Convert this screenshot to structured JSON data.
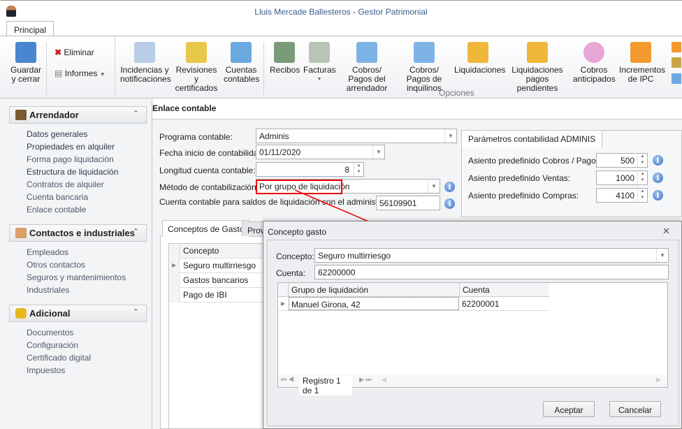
{
  "window": {
    "title": "Lluis Mercade Ballesteros - Gestor Patrimonial"
  },
  "ribbon": {
    "tab": "Principal",
    "group_label": "Opciones",
    "save": "Guardar y cerrar",
    "delete": "Eliminar",
    "reports": "Informes",
    "buttons": [
      "Incidencias y notificaciones",
      "Revisiones y certificados",
      "Cuentas contables",
      "Recibos",
      "Facturas",
      "Cobros/ Pagos del arrendador",
      "Cobros/ Pagos de inquilinos",
      "Liquidaciones",
      "Liquidaciones pagos pendientes",
      "Cobros anticipados",
      "Incrementos de IPC"
    ]
  },
  "sidebar": {
    "groups": [
      {
        "title": "Arrendador",
        "items": [
          "Datos generales",
          "Propiedades en alquiler",
          "Forma pago liquidación",
          "Estructura de liquidación",
          "Contratos de alquiler",
          "Cuenta bancaria",
          "Enlace contable"
        ]
      },
      {
        "title": "Contactos e industriales",
        "items": [
          "Empleados",
          "Otros contactos",
          "Seguros y mantenimientos",
          "Industriales"
        ]
      },
      {
        "title": "Adicional",
        "items": [
          "Documentos",
          "Configuración",
          "Certificado digital",
          "Impuestos"
        ]
      }
    ]
  },
  "main": {
    "title": "Enlace contable",
    "form": {
      "programa_label": "Programa contable:",
      "programa": "Adminis",
      "fecha_label": "Fecha inicio de contabilidad:",
      "fecha": "01/11/2020",
      "longitud_label": "Longitud cuenta contable:",
      "longitud": "8",
      "metodo_label": "Método de contabilización:",
      "metodo": "Por grupo de liquidación",
      "cuenta_label": "Cuenta contable para saldos de liquidación con el administrador",
      "cuenta": "56109901"
    },
    "admin": {
      "tab": "Parámetros contabilidad ADMINIS",
      "rows": [
        {
          "label": "Asiento  predefinido Cobros / Pagos:",
          "value": "500"
        },
        {
          "label": "Asiento  predefinido Ventas:",
          "value": "1000"
        },
        {
          "label": "Asiento predefinido Compras:",
          "value": "4100"
        }
      ]
    },
    "tabs": [
      "Conceptos de Gasto",
      "Prov"
    ],
    "grid": {
      "header": "Concepto",
      "rows": [
        "Seguro multirriesgo",
        "Gastos bancarios",
        "Pago de IBI"
      ]
    }
  },
  "dialog": {
    "title": "Concepto gasto",
    "concepto_label": "Concepto:",
    "concepto": "Seguro multirriesgo",
    "cuenta_label": "Cuenta:",
    "cuenta": "62200000",
    "grid": {
      "headers": [
        "Grupo de liquidación",
        "Cuenta"
      ],
      "rows": [
        [
          "Manuel Girona, 42",
          "62200001"
        ]
      ]
    },
    "nav": "Registro 1 de 1",
    "accept": "Aceptar",
    "cancel": "Cancelar"
  },
  "colors": {
    "accent": "#3b5c8c",
    "highlight": "#e00000"
  }
}
